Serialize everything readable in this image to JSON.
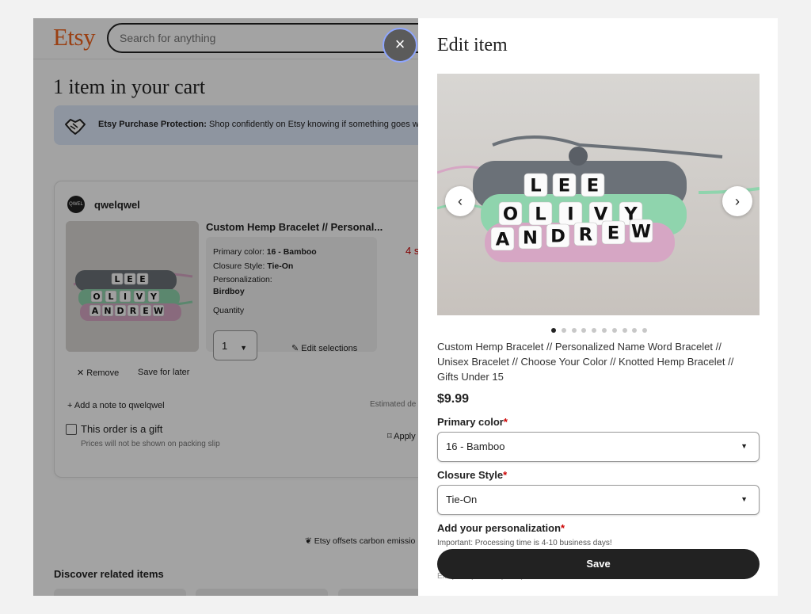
{
  "header": {
    "logo": "Etsy",
    "search_placeholder": "Search for anything"
  },
  "cart": {
    "title": "1 item in your cart",
    "protection_bold": "Etsy Purchase Protection:",
    "protection_text": " Shop confidently on Etsy knowing if something goes wro",
    "shop_avatar": "QWEL QWEL",
    "shop_name": "qwelqwel",
    "product_title": "Custom Hemp Bracelet // Personal...",
    "primary_color_label": "Primary color: ",
    "primary_color_value": "16 - Bamboo",
    "closure_label": "Closure Style: ",
    "closure_value": "Tie-On",
    "personalization_label": "Personalization:",
    "personalization_value": "Birdboy",
    "quantity_label": "Quantity",
    "quantity_value": "1",
    "edit_selections": "Edit selections",
    "price_partial": "4 s",
    "remove": "Remove",
    "save_for_later": "Save for later",
    "add_note": "Add a note to qwelqwel",
    "estimated_delivery": "Estimated de",
    "gift_label": "This order is a gift",
    "gift_sub": "Prices will not be shown on packing slip",
    "apply": "Apply",
    "carbon": "Etsy offsets carbon emissio",
    "discover": "Discover related items"
  },
  "thumbnail_words": [
    "LEE",
    "OLIVY",
    "ANDREW"
  ],
  "modal": {
    "close_label": "×",
    "title": "Edit item",
    "image_words": [
      "LEE",
      "OLIVY",
      "ANDREW"
    ],
    "prev_label": "‹",
    "next_label": "›",
    "dots": 10,
    "active_dot": 0,
    "description": "Custom Hemp Bracelet // Personalized Name Word Bracelet // Unisex Bracelet // Choose Your Color // Knotted Hemp Bracelet // Gifts Under 15",
    "price": "$9.99",
    "primary_color_label": "Primary color",
    "primary_color_value": "16 - Bamboo",
    "closure_label": "Closure Style",
    "closure_value": "Tie-On",
    "personalization_label": "Add your personalization",
    "required_mark": "*",
    "personalization_hint": "Important: Processing time is 4-10 business days!",
    "personalization_example": "Ex: (heart) JOHN (heart)",
    "save_label": "Save"
  },
  "colors": {
    "accent": "#f1641e",
    "protection_bg": "#dfe9fb",
    "required": "#cc0000",
    "save_bg": "#222222",
    "bracelet_grey": "#6b7178",
    "bracelet_mint": "#8fd4ad",
    "bracelet_pink": "#d6a6c4"
  }
}
